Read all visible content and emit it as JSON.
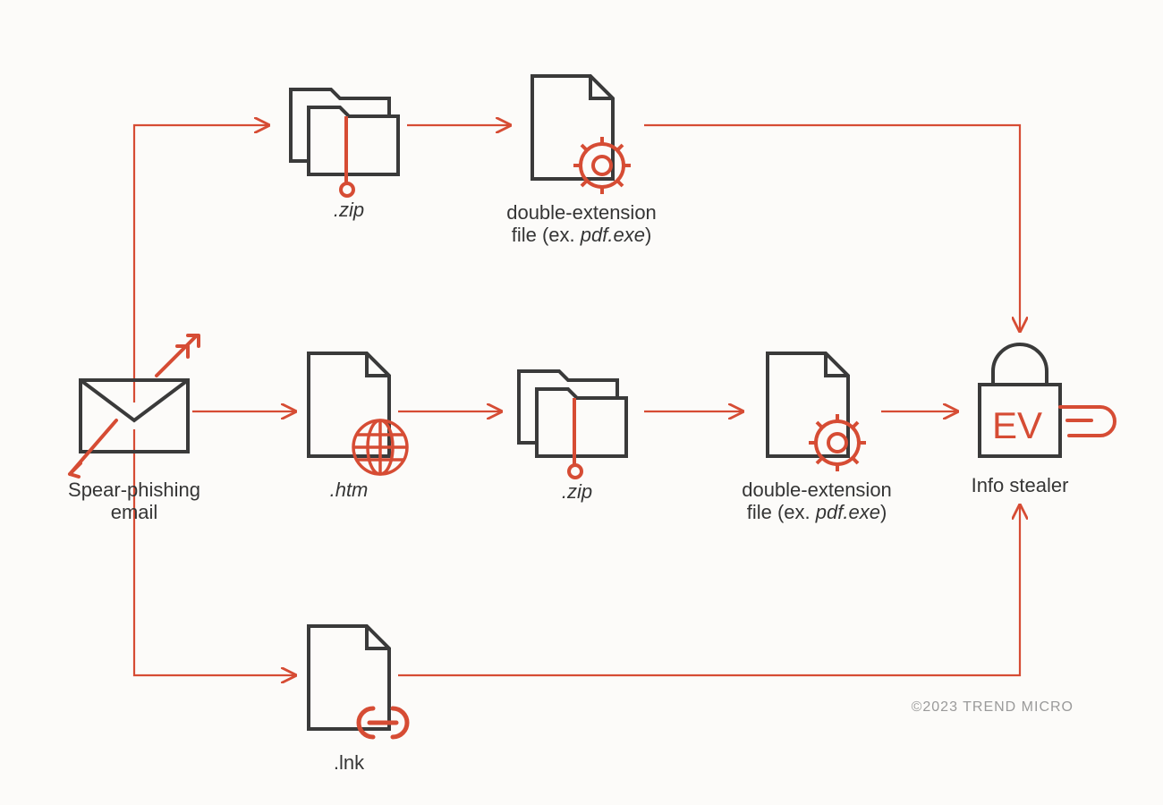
{
  "colors": {
    "accent": "#d64c34",
    "stroke": "#3a3a3a",
    "bg": "#fcfbf9",
    "muted": "#9a9a9a"
  },
  "copyright": "©2023 TREND MICRO",
  "nodes": {
    "email": {
      "label_line1": "Spear-phishing",
      "label_line2": "email",
      "icon": "envelope-spear-icon"
    },
    "zip1": {
      "label": ".zip",
      "icon": "folder-drop-icon"
    },
    "dblext1": {
      "label_line1": "double-extension",
      "label_line2_prefix": "file (ex. ",
      "label_line2_italic": "pdf.exe",
      "label_line2_suffix": ")",
      "icon": "file-gear-icon"
    },
    "htm": {
      "label": ".htm",
      "icon": "file-globe-icon"
    },
    "zip2": {
      "label": ".zip",
      "icon": "folder-drop-icon"
    },
    "dblext2": {
      "label_line1": "double-extension",
      "label_line2_prefix": "file (ex. ",
      "label_line2_italic": "pdf.exe",
      "label_line2_suffix": ")",
      "icon": "file-gear-icon"
    },
    "lnk": {
      "label": ".lnk",
      "icon": "file-link-icon"
    },
    "infostealer": {
      "label": "Info stealer",
      "badge_text": "EV",
      "icon": "lock-ev-icon"
    }
  },
  "flows": [
    [
      "email",
      "zip1",
      "dblext1",
      "infostealer"
    ],
    [
      "email",
      "htm",
      "zip2",
      "dblext2",
      "infostealer"
    ],
    [
      "email",
      "lnk",
      "infostealer"
    ]
  ]
}
